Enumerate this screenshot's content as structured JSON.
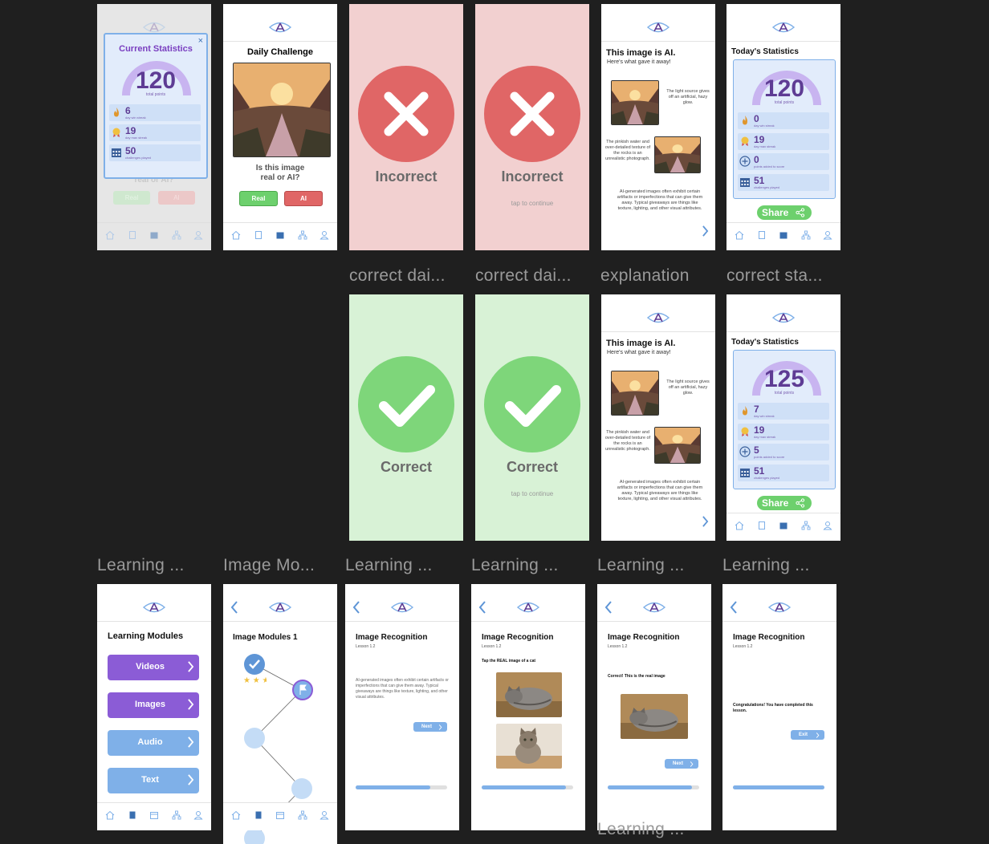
{
  "labels": {
    "correct_daily_1": "correct dai...",
    "correct_daily_2": "correct dai...",
    "explanation": "explanation",
    "correct_stats": "correct sta...",
    "learning_1": "Learning ...",
    "image_modules": "Image Mo...",
    "learning_2": "Learning ...",
    "learning_3": "Learning ...",
    "learning_4": "Learning ...",
    "learning_5": "Learning ...",
    "learning_6": "Learning ..."
  },
  "stats_popup": {
    "title": "Current Statistics",
    "close": "×",
    "points": "120",
    "points_label": "total points",
    "rows": [
      {
        "value": "6",
        "label": "day win streak",
        "icon": "flame-icon"
      },
      {
        "value": "19",
        "label": "day max streak",
        "icon": "medal-icon"
      },
      {
        "value": "50",
        "label": "challenges played",
        "icon": "calendar-icon"
      }
    ],
    "bg_question": "real or AI?",
    "bg_real": "Real",
    "bg_ai": "AI"
  },
  "daily": {
    "title": "Daily Challenge",
    "question": "Is this image real or AI?",
    "real_label": "Real",
    "ai_label": "AI"
  },
  "incorrect": {
    "label": "Incorrect",
    "tap": "tap to continue"
  },
  "correct": {
    "label": "Correct",
    "tap": "tap to continue"
  },
  "explanation_screen": {
    "title": "This image is AI.",
    "subtitle": "Here's what gave it away!",
    "note1": "The light source gives off an artificial, hazy glow.",
    "note2": "The pinkish water and over-detailed texture of the rocks is an unrealistic photograph.",
    "note3": "AI-generated images often exhibit certain artifacts or imperfections that can give them away. Typical giveaways are things like texture, lighting, and other visual attributes."
  },
  "stats_today_1": {
    "title": "Today's Statistics",
    "points": "120",
    "points_label": "total points",
    "rows": [
      {
        "value": "0",
        "label": "day win streak",
        "icon": "flame-icon"
      },
      {
        "value": "19",
        "label": "day max streak",
        "icon": "medal-icon"
      },
      {
        "value": "0",
        "label": "points added to score",
        "icon": "plus-circle-icon"
      },
      {
        "value": "51",
        "label": "challenges played",
        "icon": "calendar-icon"
      }
    ],
    "share": "Share"
  },
  "stats_today_2": {
    "title": "Today's Statistics",
    "points": "125",
    "points_label": "total points",
    "rows": [
      {
        "value": "7",
        "label": "day win streak",
        "icon": "flame-icon"
      },
      {
        "value": "19",
        "label": "day max streak",
        "icon": "medal-icon"
      },
      {
        "value": "5",
        "label": "points added to score",
        "icon": "plus-circle-icon"
      },
      {
        "value": "51",
        "label": "challenges played",
        "icon": "calendar-icon"
      }
    ],
    "share": "Share"
  },
  "learning_modules": {
    "title": "Learning Modules",
    "buttons": [
      "Videos",
      "Images",
      "Audio",
      "Text"
    ]
  },
  "image_modules": {
    "title": "Image Modules 1"
  },
  "lesson": {
    "title": "Image Recognition",
    "number": "Lesson 1.2",
    "intro": "AI-generated images often exhibit certain artifacts or imperfections that can give them away. Typical giveaways are things like texture, lighting, and other visual attributes.",
    "next": "Next",
    "prompt": "Tap the REAL image of a cat",
    "feedback": "Correct! This is the real image",
    "congrats": "Congratulations! You have completed this lesson.",
    "exit": "Exit"
  },
  "progress": [
    0.82,
    0.92,
    0.92,
    1.0
  ],
  "colors": {
    "accent_purple": "#8b5cd6",
    "accent_blue": "#7fb0e8",
    "correct_green": "#7ed67a",
    "incorrect_red": "#e06666",
    "correct_bg": "#d8f2d6",
    "incorrect_bg": "#f2d0d0"
  }
}
